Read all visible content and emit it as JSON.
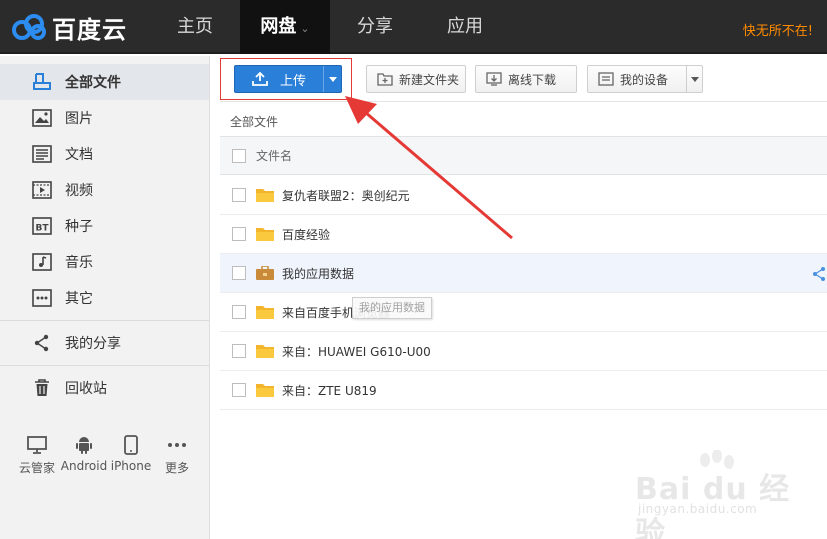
{
  "app": {
    "logo_text": "百度云",
    "user_name": "快无所不在!"
  },
  "nav": {
    "items": [
      {
        "label": "主页"
      },
      {
        "label": "网盘"
      },
      {
        "label": "分享"
      },
      {
        "label": "应用"
      }
    ],
    "active": "网盘"
  },
  "sidebar": {
    "items": [
      {
        "label": "全部文件",
        "icon": "all-files-icon"
      },
      {
        "label": "图片",
        "icon": "image-icon"
      },
      {
        "label": "文档",
        "icon": "document-icon"
      },
      {
        "label": "视频",
        "icon": "video-icon"
      },
      {
        "label": "种子",
        "icon": "torrent-icon"
      },
      {
        "label": "音乐",
        "icon": "music-icon"
      },
      {
        "label": "其它",
        "icon": "more-icon"
      }
    ],
    "share_label": "我的分享",
    "trash_label": "回收站",
    "devices": [
      {
        "label": "云管家",
        "icon": "monitor-icon"
      },
      {
        "label": "Android",
        "icon": "android-icon"
      },
      {
        "label": "iPhone",
        "icon": "phone-icon"
      },
      {
        "label": "更多",
        "icon": "more-dots-icon"
      }
    ]
  },
  "toolbar": {
    "upload_label": "上传",
    "new_folder_label": "新建文件夹",
    "offline_download_label": "离线下载",
    "my_devices_label": "我的设备"
  },
  "breadcrumb": "全部文件",
  "file_list": {
    "header_label": "文件名",
    "rows": [
      {
        "name": "复仇者联盟2：奥创纪元",
        "icon": "folder-icon"
      },
      {
        "name": "百度经验",
        "icon": "folder-icon"
      },
      {
        "name": "我的应用数据",
        "icon": "app-folder-icon"
      },
      {
        "name": "来自百度手机浏览器",
        "icon": "folder-icon"
      },
      {
        "name": "来自：HUAWEI G610-U00",
        "icon": "folder-icon"
      },
      {
        "name": "来自：ZTE U819",
        "icon": "folder-icon"
      }
    ],
    "tooltip": "我的应用数据"
  },
  "watermark": {
    "text": "Bai du 经验",
    "sub": "jingyan.baidu.com"
  },
  "colors": {
    "topbar": "#2b2b2b",
    "accent_blue": "#2a7fd8",
    "user_orange": "#ff8a00",
    "annotation_red": "#e53935"
  }
}
